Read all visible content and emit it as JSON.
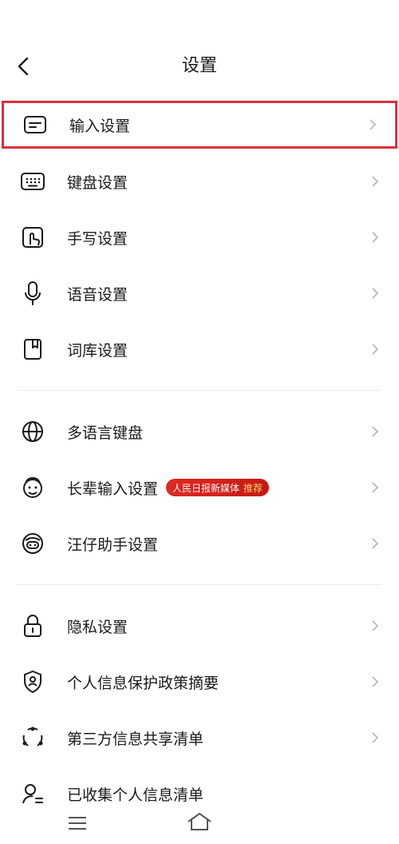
{
  "header": {
    "title": "设置",
    "back_icon": "chevron-left-icon"
  },
  "sections": [
    {
      "items": [
        {
          "label": "输入设置",
          "icon": "input-box-icon",
          "highlighted": true
        },
        {
          "label": "键盘设置",
          "icon": "keyboard-icon"
        },
        {
          "label": "手写设置",
          "icon": "handwriting-icon"
        },
        {
          "label": "语音设置",
          "icon": "microphone-icon"
        },
        {
          "label": "词库设置",
          "icon": "dictionary-icon"
        }
      ]
    },
    {
      "items": [
        {
          "label": "多语言键盘",
          "icon": "globe-icon"
        },
        {
          "label": "长辈输入设置",
          "icon": "elder-face-icon",
          "badge": {
            "text": "人民日报新媒体",
            "tag": "推荐"
          }
        },
        {
          "label": "汪仔助手设置",
          "icon": "mascot-icon"
        }
      ]
    },
    {
      "items": [
        {
          "label": "隐私设置",
          "icon": "lock-icon"
        },
        {
          "label": "个人信息保护政策摘要",
          "icon": "shield-person-icon"
        },
        {
          "label": "第三方信息共享清单",
          "icon": "share-circle-icon"
        },
        {
          "label": "已收集个人信息清单",
          "icon": "person-list-icon"
        }
      ]
    }
  ],
  "colors": {
    "highlight_border": "#d8323c",
    "badge_bg": "#d42a20",
    "badge_tag": "#ffd86a",
    "chevron": "#b5b5b5"
  },
  "nav": {
    "menu_icon": "menu-icon",
    "home_icon": "home-icon"
  }
}
